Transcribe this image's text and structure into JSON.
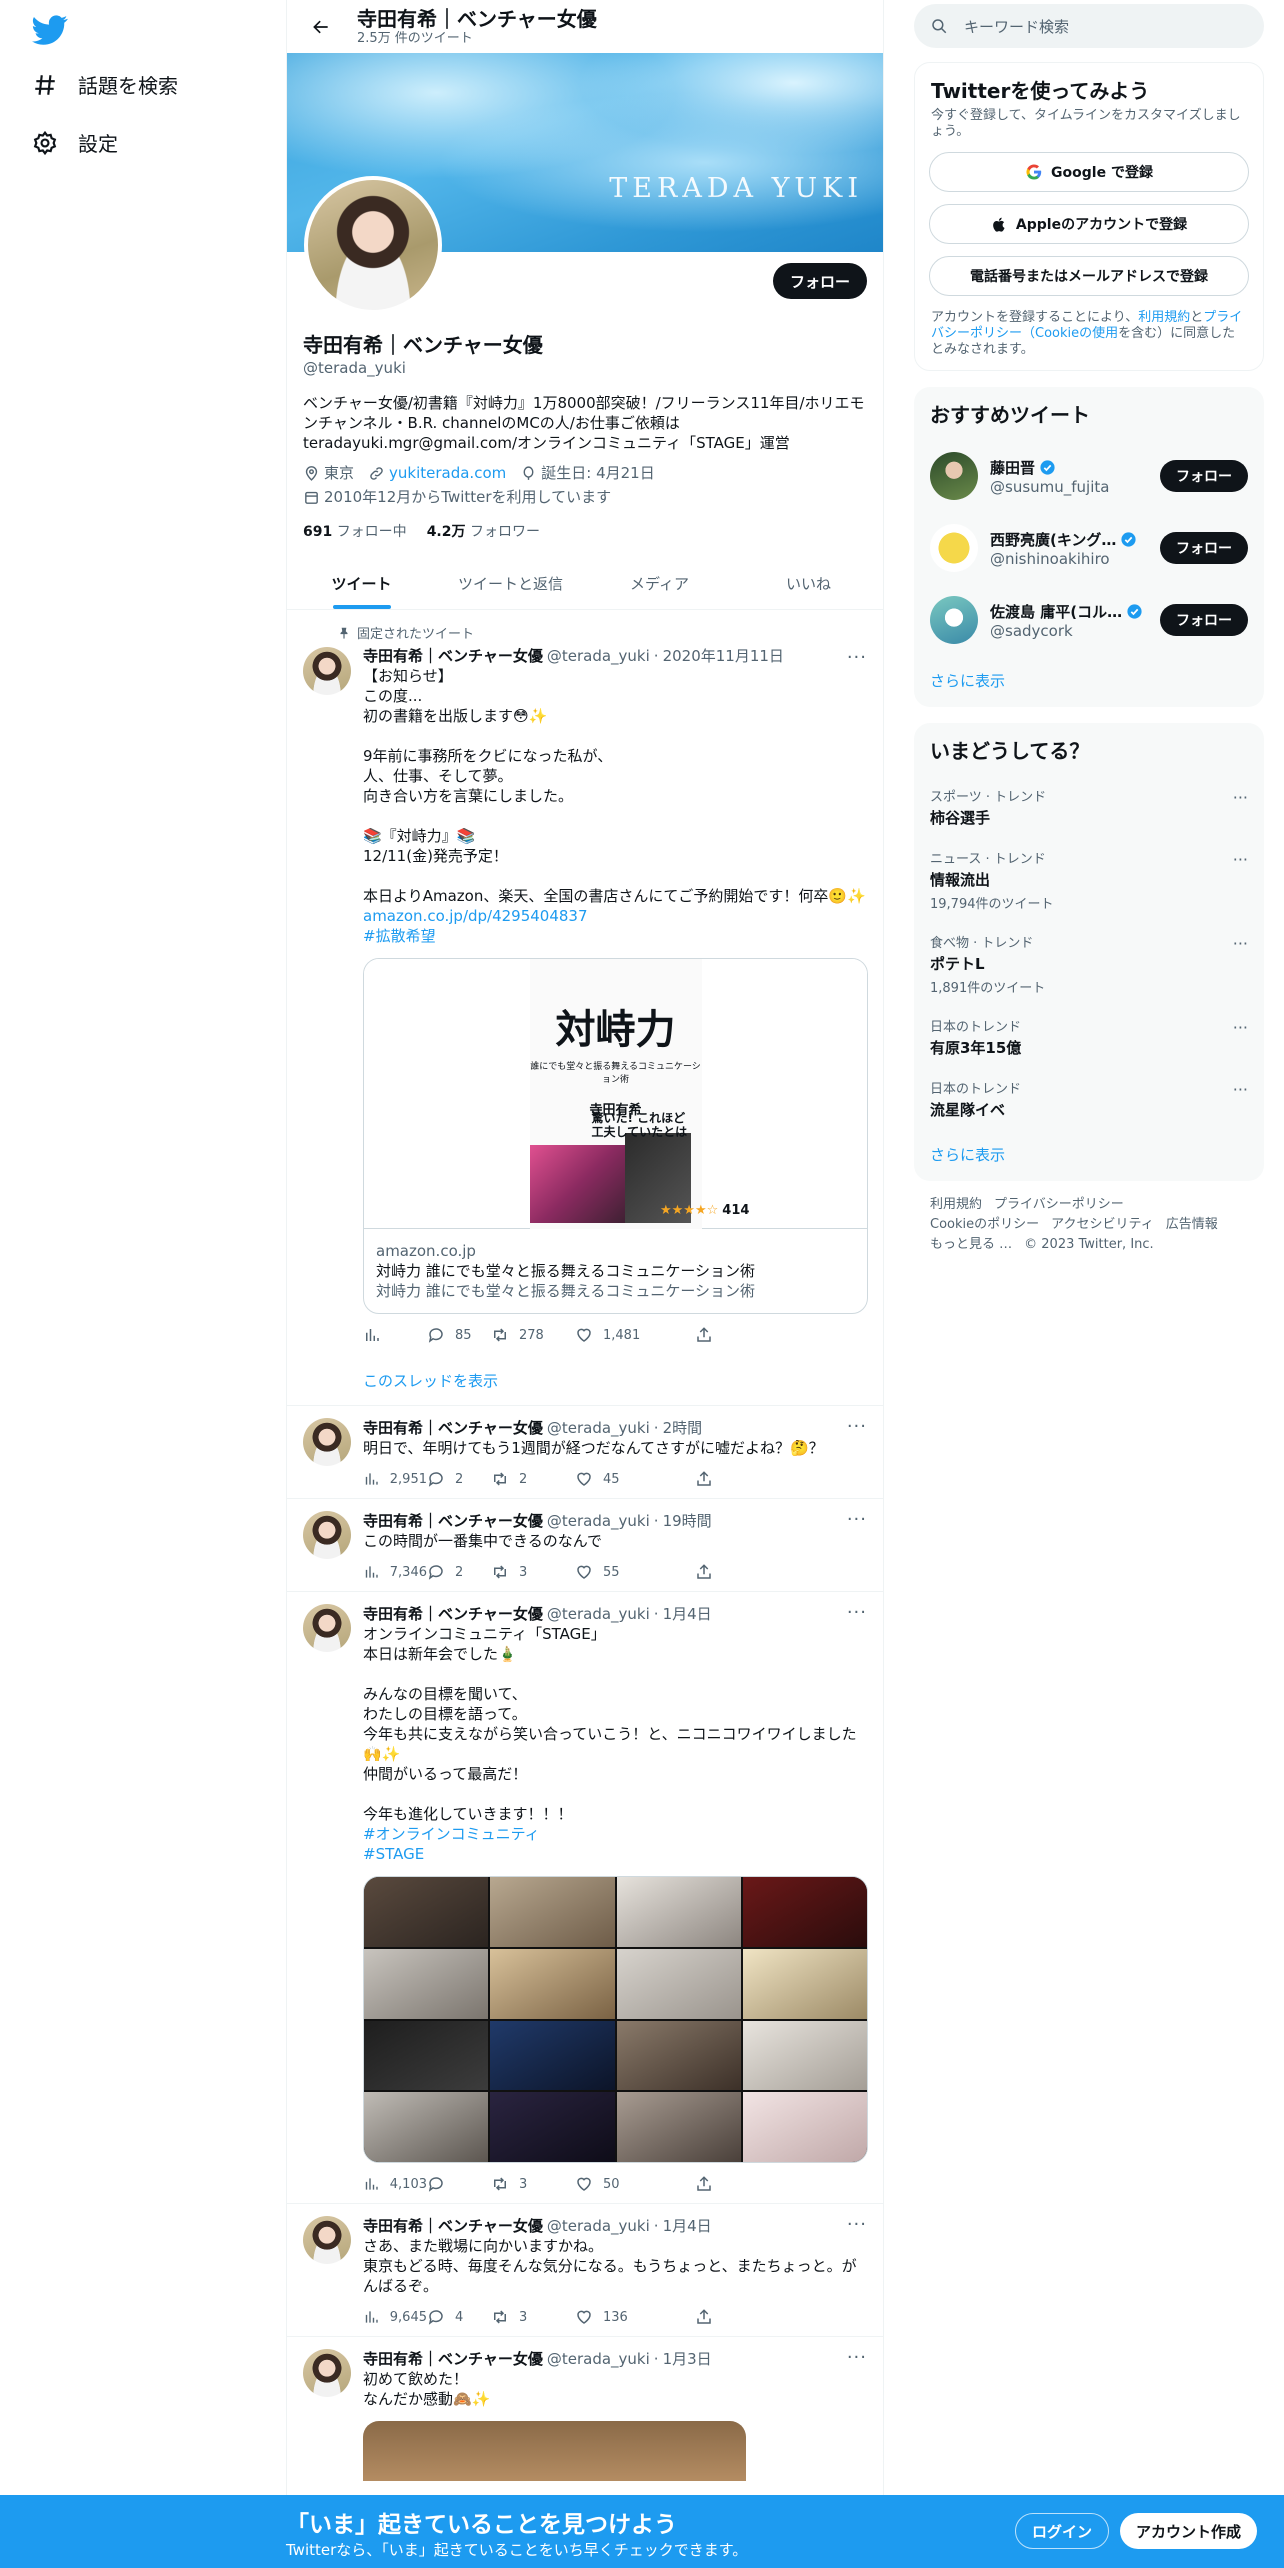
{
  "nav": {
    "explore_label": "話題を検索",
    "settings_label": "設定"
  },
  "header": {
    "title": "寺田有希｜ベンチャー女優",
    "tweet_count": "2.5万 件のツイート"
  },
  "banner": {
    "text": "TERADA YUKI"
  },
  "profile": {
    "follow_label": "フォロー",
    "name": "寺田有希｜ベンチャー女優",
    "handle": "@terada_yuki",
    "bio": "ベンチャー女優/初書籍『対峙力』1万8000部突破！/フリーランス11年目/ホリエモンチャンネル・B.R. channelのMCの人/お仕事ご依頼はteradayuki.mgr@gmail.com/オンラインコミュニティ「STAGE」運営",
    "location": "東京",
    "website": "yukiterada.com",
    "birthday": "誕生日: 4月21日",
    "joined": "2010年12月からTwitterを利用しています",
    "following_count": "691",
    "following_label": "フォロー中",
    "followers_count": "4.2万",
    "followers_label": "フォロワー"
  },
  "tabs": [
    "ツイート",
    "ツイートと返信",
    "メディア",
    "いいね"
  ],
  "tweets": [
    {
      "pinned_label": "固定されたツイート",
      "name": "寺田有希｜ベンチャー女優",
      "handle": "@terada_yuki",
      "time": "2020年11月11日",
      "body": "【お知らせ】\nこの度...\n初の書籍を出版します😳✨\n\n9年前に事務所をクビになった私が、\n人、仕事、そして夢。\n向き合い方を言葉にしました。\n\n📚『対峙力』📚\n12/11(金)発売予定！\n\n本日よりAmazon、楽天、全国の書店さんにてご予約開始です！何卒🙂✨",
      "link": "amazon.co.jp/dp/4295404837",
      "hashtag": "#拡散希望",
      "card": {
        "book_title": "対峙力",
        "book_sub": "誰にでも堂々と振る舞えるコミュニケーション術",
        "book_author": "寺田有希",
        "book_copy": "驚いた! これほど工夫していたとは",
        "rating_count": "414",
        "domain": "amazon.co.jp",
        "title": "対峙力 誰にでも堂々と振る舞えるコミュニケーション術",
        "desc": "対峙力 誰にでも堂々と振る舞えるコミュニケーション術"
      },
      "views": "",
      "replies": "85",
      "retweets": "278",
      "likes": "1,481",
      "show_thread": "このスレッドを表示"
    },
    {
      "name": "寺田有希｜ベンチャー女優",
      "handle": "@terada_yuki",
      "time": "2時間",
      "body": "明日で、年明けてもう1週間が経つだなんてさすがに嘘だよね？🤔？",
      "views": "2,951",
      "replies": "2",
      "retweets": "2",
      "likes": "45"
    },
    {
      "name": "寺田有希｜ベンチャー女優",
      "handle": "@terada_yuki",
      "time": "19時間",
      "body": "この時間が一番集中できるのなんで",
      "views": "7,346",
      "replies": "2",
      "retweets": "3",
      "likes": "55"
    },
    {
      "name": "寺田有希｜ベンチャー女優",
      "handle": "@terada_yuki",
      "time": "1月4日",
      "body": "オンラインコミュニティ「STAGE」\n本日は新年会でした🎍\n\nみんなの目標を聞いて、\nわたしの目標を語って。\n今年も共に支えながら笑い合っていこう！と、ニコニコワイワイしました🙌✨\n仲間がいるって最高だ！\n\n今年も進化していきます！！！",
      "hashtag": "#オンラインコミュニティ",
      "hashtag2": "#STAGE",
      "views": "4,103",
      "replies": "",
      "retweets": "3",
      "likes": "50"
    },
    {
      "name": "寺田有希｜ベンチャー女優",
      "handle": "@terada_yuki",
      "time": "1月4日",
      "body": "さあ、また戦場に向かいますかね。\n東京もどる時、毎度そんな気分になる。もうちょっと、またちょっと。がんばるぞ。",
      "views": "9,645",
      "replies": "4",
      "retweets": "3",
      "likes": "136"
    },
    {
      "name": "寺田有希｜ベンチャー女優",
      "handle": "@terada_yuki",
      "time": "1月3日",
      "body": "初めて飲めた！\nなんだか感動🙈✨"
    }
  ],
  "right": {
    "search_placeholder": "キーワード検索",
    "signup": {
      "title": "Twitterを使ってみよう",
      "desc": "今すぐ登録して、タイムラインをカスタマイズしましょう。",
      "google": "Google で登録",
      "apple": "Appleのアカウントで登録",
      "phone": "電話番号またはメールアドレスで登録",
      "legal_1": "アカウントを登録することにより、",
      "legal_terms": "利用規約",
      "legal_2": "と",
      "legal_privacy": "プライバシーポリシー",
      "legal_cookie": "（Cookieの使用",
      "legal_3": "を含む）に同意したとみなされます。"
    },
    "who": {
      "title": "おすすめツイート",
      "accounts": [
        {
          "name": "藤田晋",
          "handle": "@susumu_fujita",
          "follow": "フォロー"
        },
        {
          "name": "西野亮廣(キング…",
          "handle": "@nishinoakihiro",
          "follow": "フォロー"
        },
        {
          "name": "佐渡島 庸平(コル…",
          "handle": "@sadycork",
          "follow": "フォロー"
        }
      ],
      "more": "さらに表示"
    },
    "trends": {
      "title": "いまどうしてる？",
      "items": [
        {
          "cat": "スポーツ · トレンド",
          "name": "柿谷選手",
          "count": ""
        },
        {
          "cat": "ニュース · トレンド",
          "name": "情報流出",
          "count": "19,794件のツイート"
        },
        {
          "cat": "食べ物 · トレンド",
          "name": "ポテトL",
          "count": "1,891件のツイート"
        },
        {
          "cat": "日本のトレンド",
          "name": "有原3年15億",
          "count": ""
        },
        {
          "cat": "日本のトレンド",
          "name": "流星隊イベ",
          "count": ""
        }
      ],
      "more": "さらに表示"
    },
    "footer": {
      "terms": "利用規約",
      "privacy": "プライバシーポリシー",
      "cookie": "Cookieのポリシー",
      "accessibility": "アクセシビリティ",
      "ads": "広告情報",
      "more": "もっと見る …",
      "copyright": "© 2023 Twitter, Inc."
    }
  },
  "bottombar": {
    "title": "「いま」起きていることを見つけよう",
    "sub": "Twitterなら、「いま」起きていることをいち早くチェックできます。",
    "login": "ログイン",
    "signup": "アカウント作成"
  },
  "colors": {
    "accent": "#1d9bf0",
    "text": "#0f1419",
    "muted": "#536471"
  }
}
